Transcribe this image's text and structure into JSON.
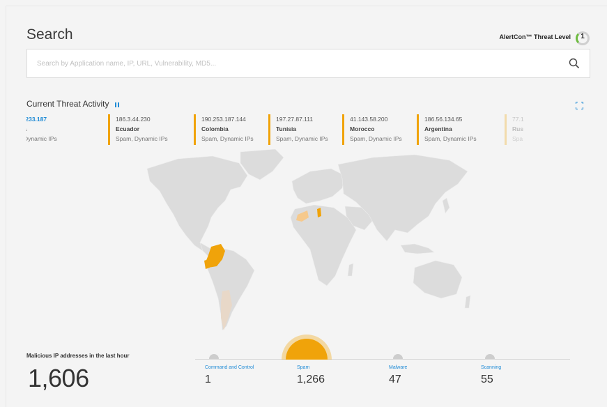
{
  "header": {
    "title": "Search",
    "threat_level_label": "AlertCon™ Threat Level",
    "threat_level_value": "1"
  },
  "search": {
    "placeholder": "Search by Application name, IP, URL, Vulnerability, MD5..."
  },
  "threat_activity": {
    "title": "Current Threat Activity",
    "items": [
      {
        "ip": ".233.187",
        "country": "a",
        "type": "Dynamic IPs"
      },
      {
        "ip": "186.3.44.230",
        "country": "Ecuador",
        "type": "Spam, Dynamic IPs"
      },
      {
        "ip": "190.253.187.144",
        "country": "Colombia",
        "type": "Spam, Dynamic IPs"
      },
      {
        "ip": "197.27.87.111",
        "country": "Tunisia",
        "type": "Spam, Dynamic IPs"
      },
      {
        "ip": "41.143.58.200",
        "country": "Morocco",
        "type": "Spam, Dynamic IPs"
      },
      {
        "ip": "186.56.134.65",
        "country": "Argentina",
        "type": "Spam, Dynamic IPs"
      },
      {
        "ip": "77.1",
        "country": "Rus",
        "type": "Spa"
      }
    ]
  },
  "map": {
    "highlighted_countries": [
      "Colombia",
      "Ecuador",
      "Tunisia",
      "Morocco",
      "Argentina"
    ],
    "colors": {
      "land": "#dcdcdc",
      "active": "#f0a30a",
      "recent": "#f6c98c",
      "faded": "#e8d8c8"
    }
  },
  "stats": {
    "label": "Malicious IP addresses in the last hour",
    "total": "1,606",
    "categories": [
      {
        "label": "Command and Control",
        "value": "1"
      },
      {
        "label": "Spam",
        "value": "1,266"
      },
      {
        "label": "Malware",
        "value": "47"
      },
      {
        "label": "Scanning",
        "value": "55"
      }
    ]
  },
  "colors": {
    "accent": "#1f8bd6",
    "warning": "#f0a30a",
    "threat_ok": "#6dbb3f"
  }
}
